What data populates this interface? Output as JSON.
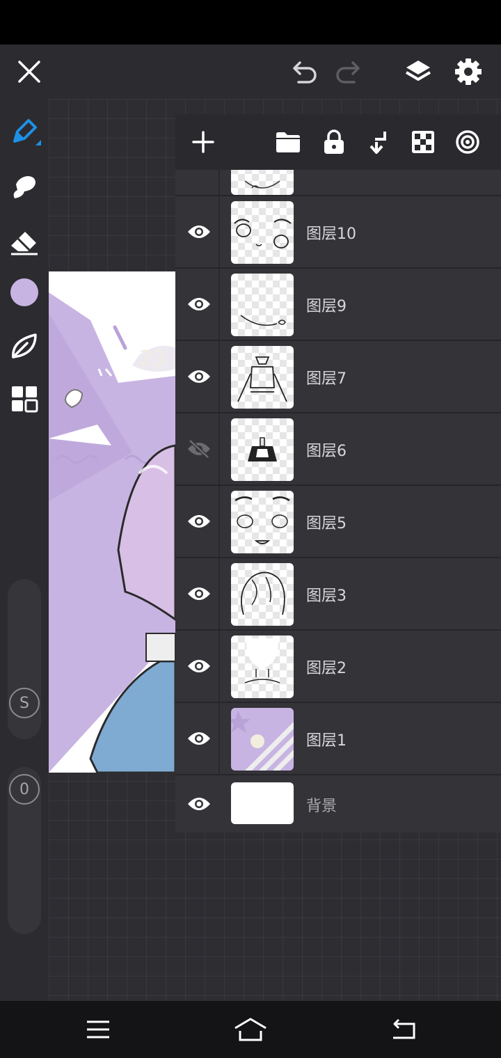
{
  "colors": {
    "accent": "#1e90e6",
    "current_brush_color": "#c8b4e2",
    "panel": "#343338",
    "icon": "#ffffff"
  },
  "topbar": {
    "icons": [
      "close-icon",
      "undo-icon",
      "redo-icon",
      "layers-icon",
      "settings-icon"
    ]
  },
  "left_toolbar": {
    "tools": [
      "brush-tool-icon",
      "smudge-tool-icon",
      "eraser-tool-icon",
      "color-swatch",
      "pen-shape-icon",
      "gallery-grid-icon"
    ],
    "size_slider_label": "S",
    "opacity_slider_label": "0"
  },
  "layers_panel": {
    "toolbar_icons": [
      "add-layer-icon",
      "folder-icon",
      "lock-icon",
      "merge-down-icon",
      "transparency-icon",
      "blend-icon"
    ],
    "layers": [
      {
        "name": "图层10",
        "visible": true
      },
      {
        "name": "图层9",
        "visible": true
      },
      {
        "name": "图层7",
        "visible": true
      },
      {
        "name": "图层6",
        "visible": false
      },
      {
        "name": "图层5",
        "visible": true
      },
      {
        "name": "图层3",
        "visible": true
      },
      {
        "name": "图层2",
        "visible": true
      },
      {
        "name": "图层1",
        "visible": true
      }
    ],
    "background_layer": {
      "name": "背景",
      "visible": true
    }
  },
  "nav_bar": {
    "icons": [
      "menu-icon",
      "home-icon",
      "back-icon"
    ]
  }
}
